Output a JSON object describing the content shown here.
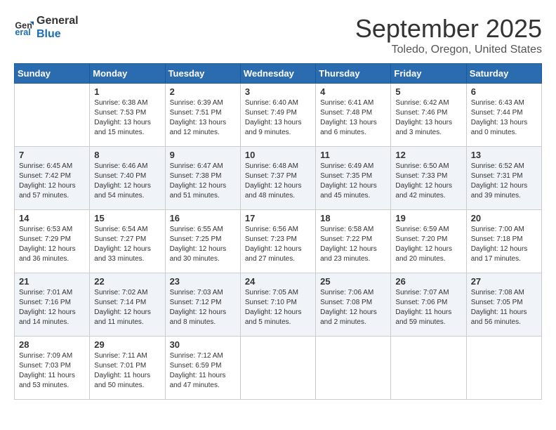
{
  "logo": {
    "line1": "General",
    "line2": "Blue"
  },
  "title": "September 2025",
  "location": "Toledo, Oregon, United States",
  "weekdays": [
    "Sunday",
    "Monday",
    "Tuesday",
    "Wednesday",
    "Thursday",
    "Friday",
    "Saturday"
  ],
  "weeks": [
    [
      {
        "day": "",
        "info": ""
      },
      {
        "day": "1",
        "info": "Sunrise: 6:38 AM\nSunset: 7:53 PM\nDaylight: 13 hours\nand 15 minutes."
      },
      {
        "day": "2",
        "info": "Sunrise: 6:39 AM\nSunset: 7:51 PM\nDaylight: 13 hours\nand 12 minutes."
      },
      {
        "day": "3",
        "info": "Sunrise: 6:40 AM\nSunset: 7:49 PM\nDaylight: 13 hours\nand 9 minutes."
      },
      {
        "day": "4",
        "info": "Sunrise: 6:41 AM\nSunset: 7:48 PM\nDaylight: 13 hours\nand 6 minutes."
      },
      {
        "day": "5",
        "info": "Sunrise: 6:42 AM\nSunset: 7:46 PM\nDaylight: 13 hours\nand 3 minutes."
      },
      {
        "day": "6",
        "info": "Sunrise: 6:43 AM\nSunset: 7:44 PM\nDaylight: 13 hours\nand 0 minutes."
      }
    ],
    [
      {
        "day": "7",
        "info": "Sunrise: 6:45 AM\nSunset: 7:42 PM\nDaylight: 12 hours\nand 57 minutes."
      },
      {
        "day": "8",
        "info": "Sunrise: 6:46 AM\nSunset: 7:40 PM\nDaylight: 12 hours\nand 54 minutes."
      },
      {
        "day": "9",
        "info": "Sunrise: 6:47 AM\nSunset: 7:38 PM\nDaylight: 12 hours\nand 51 minutes."
      },
      {
        "day": "10",
        "info": "Sunrise: 6:48 AM\nSunset: 7:37 PM\nDaylight: 12 hours\nand 48 minutes."
      },
      {
        "day": "11",
        "info": "Sunrise: 6:49 AM\nSunset: 7:35 PM\nDaylight: 12 hours\nand 45 minutes."
      },
      {
        "day": "12",
        "info": "Sunrise: 6:50 AM\nSunset: 7:33 PM\nDaylight: 12 hours\nand 42 minutes."
      },
      {
        "day": "13",
        "info": "Sunrise: 6:52 AM\nSunset: 7:31 PM\nDaylight: 12 hours\nand 39 minutes."
      }
    ],
    [
      {
        "day": "14",
        "info": "Sunrise: 6:53 AM\nSunset: 7:29 PM\nDaylight: 12 hours\nand 36 minutes."
      },
      {
        "day": "15",
        "info": "Sunrise: 6:54 AM\nSunset: 7:27 PM\nDaylight: 12 hours\nand 33 minutes."
      },
      {
        "day": "16",
        "info": "Sunrise: 6:55 AM\nSunset: 7:25 PM\nDaylight: 12 hours\nand 30 minutes."
      },
      {
        "day": "17",
        "info": "Sunrise: 6:56 AM\nSunset: 7:23 PM\nDaylight: 12 hours\nand 27 minutes."
      },
      {
        "day": "18",
        "info": "Sunrise: 6:58 AM\nSunset: 7:22 PM\nDaylight: 12 hours\nand 23 minutes."
      },
      {
        "day": "19",
        "info": "Sunrise: 6:59 AM\nSunset: 7:20 PM\nDaylight: 12 hours\nand 20 minutes."
      },
      {
        "day": "20",
        "info": "Sunrise: 7:00 AM\nSunset: 7:18 PM\nDaylight: 12 hours\nand 17 minutes."
      }
    ],
    [
      {
        "day": "21",
        "info": "Sunrise: 7:01 AM\nSunset: 7:16 PM\nDaylight: 12 hours\nand 14 minutes."
      },
      {
        "day": "22",
        "info": "Sunrise: 7:02 AM\nSunset: 7:14 PM\nDaylight: 12 hours\nand 11 minutes."
      },
      {
        "day": "23",
        "info": "Sunrise: 7:03 AM\nSunset: 7:12 PM\nDaylight: 12 hours\nand 8 minutes."
      },
      {
        "day": "24",
        "info": "Sunrise: 7:05 AM\nSunset: 7:10 PM\nDaylight: 12 hours\nand 5 minutes."
      },
      {
        "day": "25",
        "info": "Sunrise: 7:06 AM\nSunset: 7:08 PM\nDaylight: 12 hours\nand 2 minutes."
      },
      {
        "day": "26",
        "info": "Sunrise: 7:07 AM\nSunset: 7:06 PM\nDaylight: 11 hours\nand 59 minutes."
      },
      {
        "day": "27",
        "info": "Sunrise: 7:08 AM\nSunset: 7:05 PM\nDaylight: 11 hours\nand 56 minutes."
      }
    ],
    [
      {
        "day": "28",
        "info": "Sunrise: 7:09 AM\nSunset: 7:03 PM\nDaylight: 11 hours\nand 53 minutes."
      },
      {
        "day": "29",
        "info": "Sunrise: 7:11 AM\nSunset: 7:01 PM\nDaylight: 11 hours\nand 50 minutes."
      },
      {
        "day": "30",
        "info": "Sunrise: 7:12 AM\nSunset: 6:59 PM\nDaylight: 11 hours\nand 47 minutes."
      },
      {
        "day": "",
        "info": ""
      },
      {
        "day": "",
        "info": ""
      },
      {
        "day": "",
        "info": ""
      },
      {
        "day": "",
        "info": ""
      }
    ]
  ]
}
